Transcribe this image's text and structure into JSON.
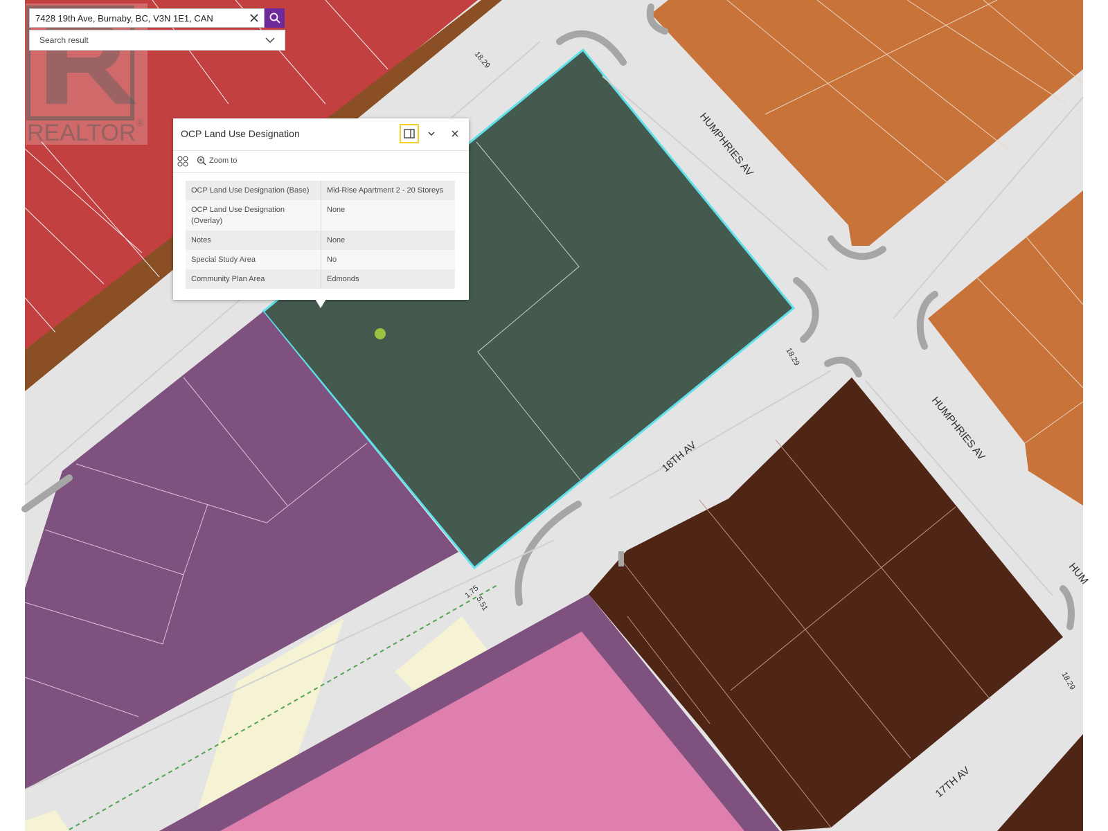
{
  "search": {
    "value": "7428 19th Ave, Burnaby, BC, V3N 1E1, CAN",
    "results_placeholder": "Search result"
  },
  "popup": {
    "title": "OCP Land Use Designation",
    "zoom_label": "Zoom to",
    "rows": [
      {
        "key": "OCP Land Use Designation (Base)",
        "value": "Mid-Rise Apartment 2 - 20 Storeys"
      },
      {
        "key": "OCP Land Use Designation (Overlay)",
        "value": "None"
      },
      {
        "key": "Notes",
        "value": "None"
      },
      {
        "key": "Special Study Area",
        "value": "No"
      },
      {
        "key": "Community Plan Area",
        "value": "Edmonds"
      }
    ]
  },
  "watermark": {
    "text": "REALTOR",
    "mark": "®"
  },
  "map": {
    "streets": {
      "humphries_ne": "HUMPHRIES AV",
      "humphries_e": "HUMPHRIES AV",
      "eighteenth": "18TH AV",
      "seventeenth": "17TH AV",
      "hum_edge": "HUM"
    },
    "dimensions": {
      "d1": "18.29",
      "d2": "18.29",
      "d3": "18.29",
      "d4": "1.75",
      "d5": "5.51"
    },
    "colors": {
      "red_zone": "#c34040",
      "brown_strip": "#8a4f24",
      "orange_zone": "#c8733a",
      "green_zone": "#445a4e",
      "purple_zone": "#7f517f",
      "dark_brown_zone": "#4f2516",
      "pink_zone": "#de7fae",
      "pale_yellow": "#f5f3d4",
      "road": "#e4e4e4",
      "road_edge": "#a6a6a6",
      "highlight": "#5fe0ea",
      "search_button": "#6e2a9b"
    }
  }
}
